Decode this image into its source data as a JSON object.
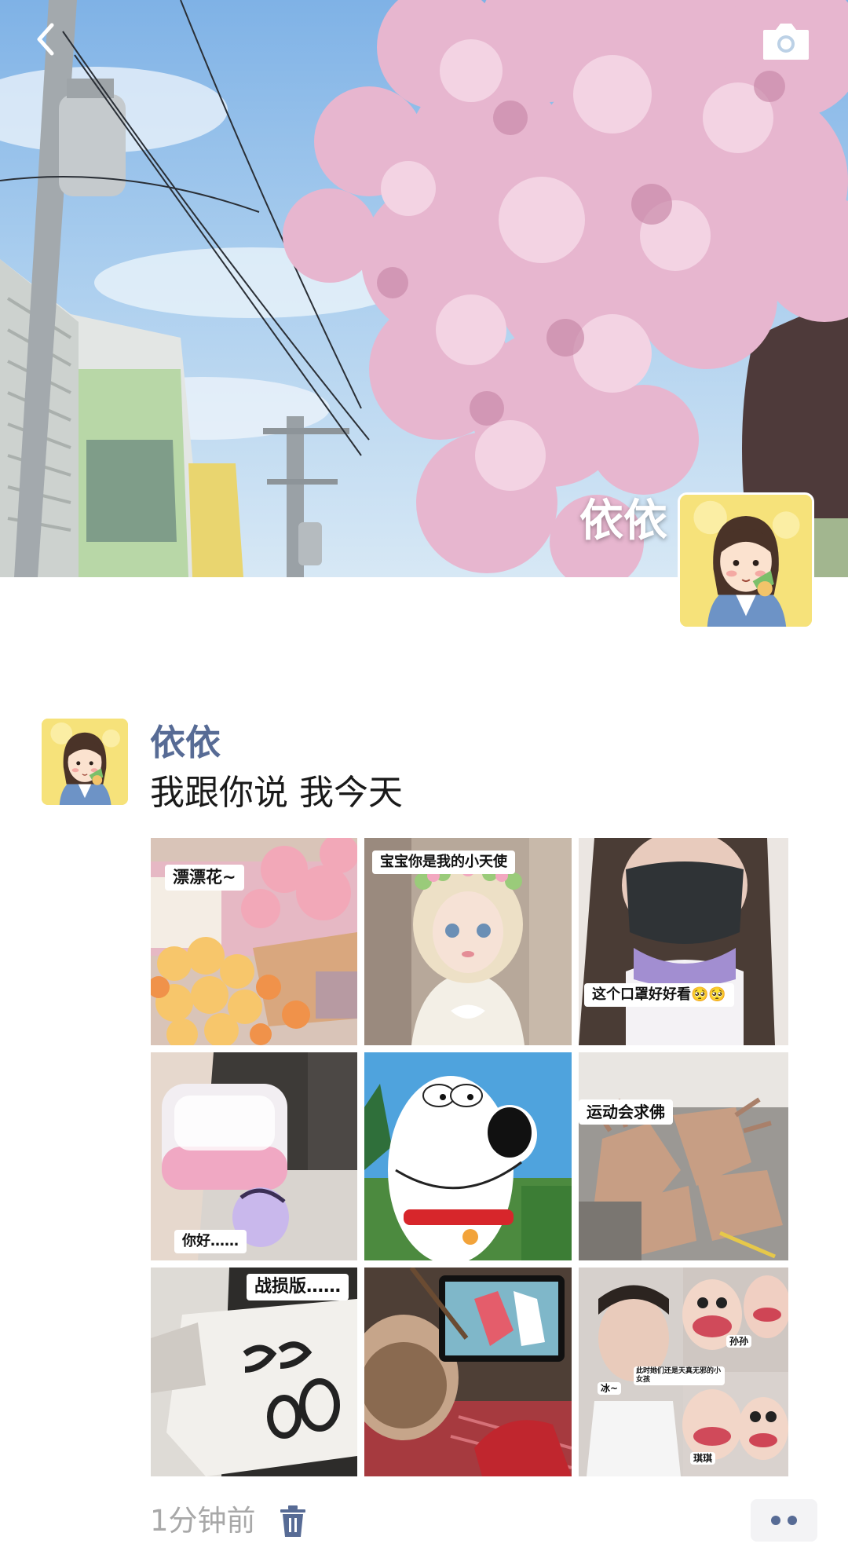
{
  "colors": {
    "author_link": "#576b95",
    "timestamp": "#a8a8a8",
    "body_text": "#1a1a1a",
    "more_button_bg": "#f3f3f5"
  },
  "icons": {
    "back": "chevron-left-icon",
    "camera": "camera-icon",
    "delete": "trash-icon",
    "more": "more-dots-icon"
  },
  "cover": {
    "name": "依依"
  },
  "post": {
    "author": "依依",
    "text": "我跟你说 我今天",
    "photos": [
      {
        "caption": "漂漂花~"
      },
      {
        "caption": "宝宝你是我的小天使"
      },
      {
        "caption": "这个口罩好好看🥺🥺"
      },
      {
        "caption": "你好……"
      },
      {
        "caption": ""
      },
      {
        "caption": "运动会求佛"
      },
      {
        "caption": "战损版……"
      },
      {
        "caption": ""
      },
      {
        "caption": "孙孙",
        "caption_2": "冰~",
        "caption_3": "琪琪",
        "caption_4": "此时她们还是天真无邪的小女孩"
      }
    ],
    "time": "1分钟前"
  }
}
